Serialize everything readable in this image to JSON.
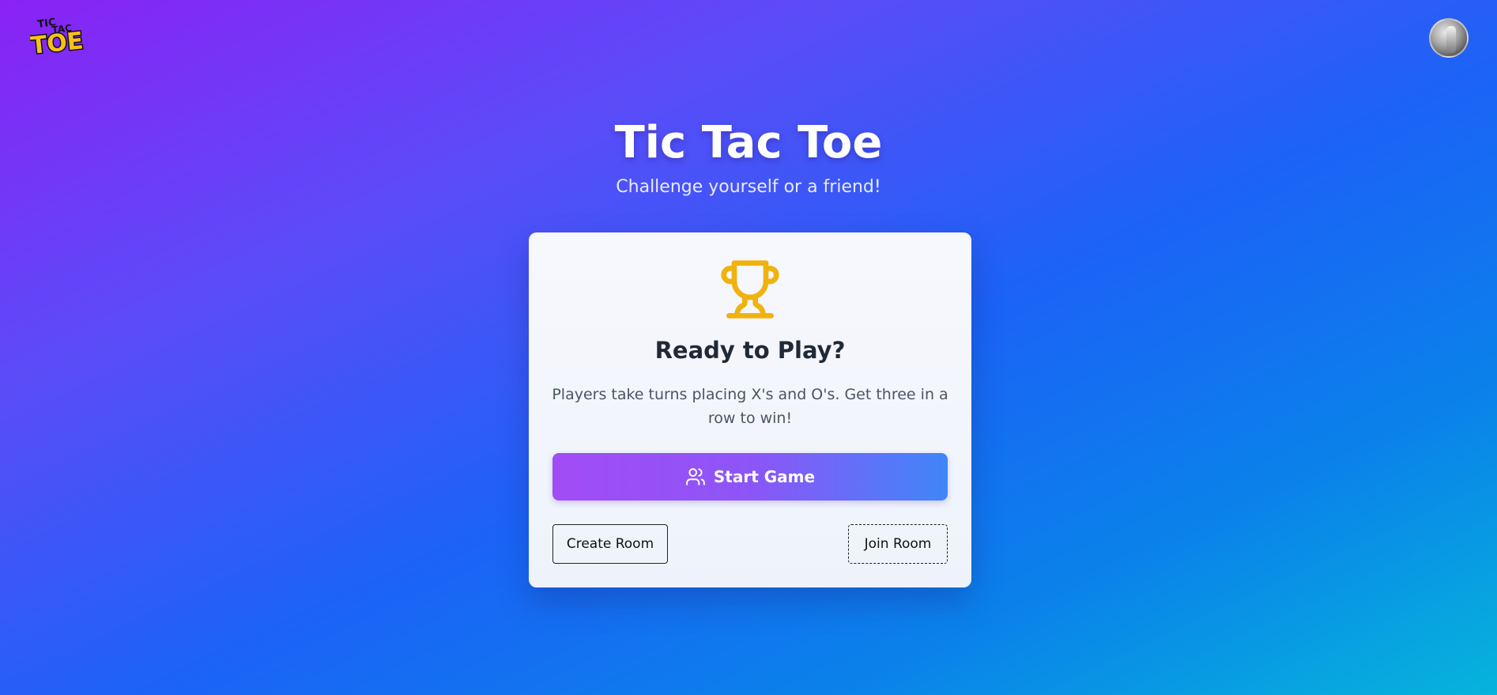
{
  "logo": {
    "line1": "TIC",
    "line2": "TAC",
    "line3": "TOE"
  },
  "header": {
    "title": "Tic Tac Toe",
    "subtitle": "Challenge yourself or a friend!"
  },
  "card": {
    "icon": "trophy-icon",
    "heading": "Ready to Play?",
    "description": "Players take turns placing X's and O's. Get three in a row to win!",
    "start_button": {
      "label": "Start Game",
      "icon": "users-icon"
    },
    "create_room_button": "Create Room",
    "join_room_button": "Join Room"
  },
  "colors": {
    "accent_start": "#a24cf6",
    "accent_end": "#3f86f8",
    "trophy": "#f0b20e"
  }
}
